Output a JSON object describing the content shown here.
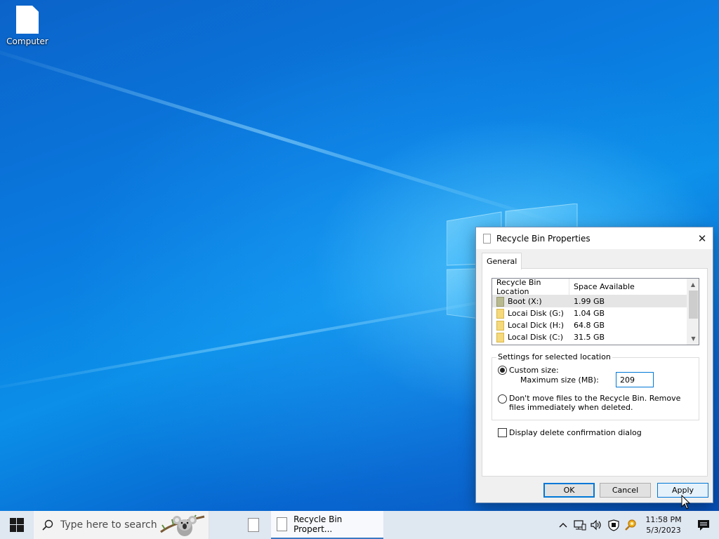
{
  "desktop": {
    "icons": [
      {
        "label": "Computer",
        "icon": "file-icon"
      }
    ]
  },
  "dialog": {
    "title": "Recycle Bin Properties",
    "tabs": [
      {
        "label": "General",
        "active": true
      }
    ],
    "list": {
      "columns": [
        "Recycle Bin Location",
        "Space Available"
      ],
      "rows": [
        {
          "location": "Boot (X:)",
          "space": "1.99 GB",
          "selected": true
        },
        {
          "location": "Locai Disk (G:)",
          "space": "1.04 GB"
        },
        {
          "location": "Local Dick (H:)",
          "space": "64.8 GB"
        },
        {
          "location": "Local Disk (C:)",
          "space": "31.5 GB"
        }
      ]
    },
    "settings": {
      "legend": "Settings for selected location",
      "custom_label": "Custom size:",
      "custom_selected": true,
      "max_size_label": "Maximum size (MB):",
      "max_size_value": "209",
      "dont_move_label": "Don't move files to the Recycle Bin. Remove files immediately when deleted."
    },
    "confirm_label": "Display delete confirmation dialog",
    "confirm_checked": false,
    "buttons": {
      "ok": "OK",
      "cancel": "Cancel",
      "apply": "Apply"
    }
  },
  "taskbar": {
    "search_placeholder": "Type here to search",
    "active_app_label": "Recycle Bin Propert...",
    "time": "11:58 PM",
    "date": "5/3/2023"
  },
  "colors": {
    "accent": "#0078d7",
    "wallpaper": "#0a6fd6"
  }
}
